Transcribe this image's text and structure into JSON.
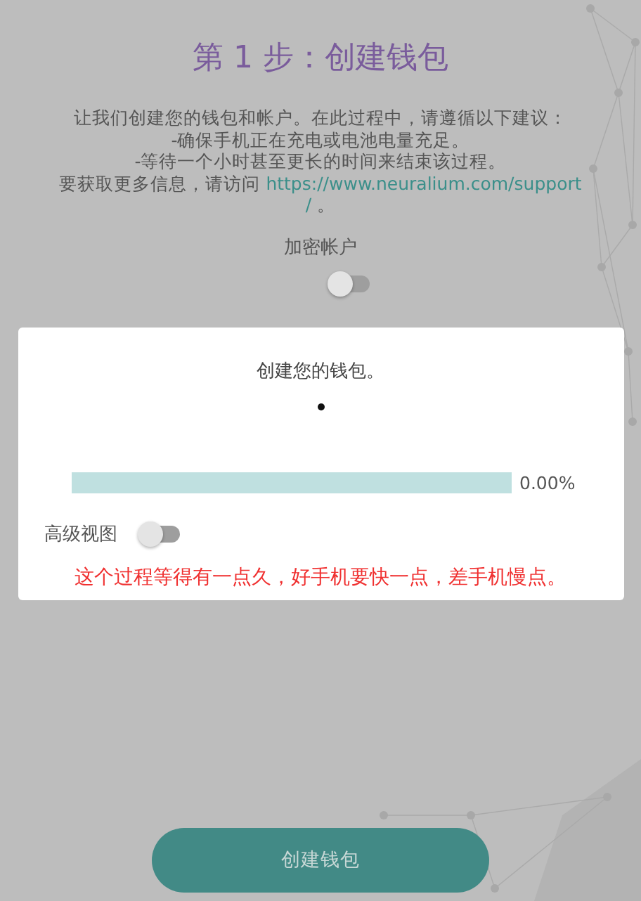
{
  "title": "第 1 步：创建钱包",
  "intro": {
    "lines": [
      "让我们创建您的钱包和帐户。在此过程中，请遵循以下建议：",
      "-确保手机正在充电或电池电量充足。",
      "-等待一个小时甚至更长的时间来结束该过程。"
    ],
    "more_prefix": "要获取更多信息，请访问 ",
    "link": "https://www.neuralium.com/support/",
    "suffix": " 。"
  },
  "encrypt_toggle": {
    "label": "加密帐户",
    "on": false
  },
  "dialog": {
    "message": "创建您的钱包。",
    "progress": {
      "level": 0,
      "reading": "0.00%"
    },
    "advanced_toggle": {
      "label": "高级视图",
      "on": false
    },
    "note": "这个过程等得有一点久，好手机要快一点，差手机慢点。"
  },
  "button": "创建钱包"
}
